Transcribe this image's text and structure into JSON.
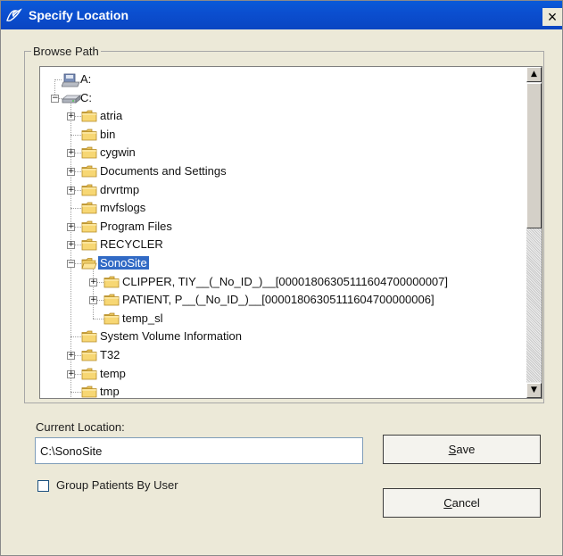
{
  "window": {
    "title": "Specify Location",
    "close_symbol": "×"
  },
  "browse": {
    "group_label": "Browse Path",
    "tree": [
      {
        "label": "A:",
        "icon": "floppy-drive-icon",
        "level": 0,
        "expander": "none"
      },
      {
        "label": "C:",
        "icon": "hard-drive-icon",
        "level": 0,
        "expander": "minus"
      },
      {
        "label": "atria",
        "icon": "folder-icon",
        "level": 1,
        "expander": "plus"
      },
      {
        "label": "bin",
        "icon": "folder-icon",
        "level": 1,
        "expander": "none"
      },
      {
        "label": "cygwin",
        "icon": "folder-icon",
        "level": 1,
        "expander": "plus"
      },
      {
        "label": "Documents and Settings",
        "icon": "folder-icon",
        "level": 1,
        "expander": "plus"
      },
      {
        "label": "drvrtmp",
        "icon": "folder-icon",
        "level": 1,
        "expander": "plus"
      },
      {
        "label": "mvfslogs",
        "icon": "folder-icon",
        "level": 1,
        "expander": "none"
      },
      {
        "label": "Program Files",
        "icon": "folder-icon",
        "level": 1,
        "expander": "plus"
      },
      {
        "label": "RECYCLER",
        "icon": "folder-icon",
        "level": 1,
        "expander": "plus"
      },
      {
        "label": "SonoSite",
        "icon": "folder-open-icon",
        "level": 1,
        "expander": "minus",
        "selected": true
      },
      {
        "label": "CLIPPER, TIY__(_No_ID_)__[00001806305111604700000007]",
        "icon": "folder-icon",
        "level": 2,
        "expander": "plus"
      },
      {
        "label": "PATIENT, P__(_No_ID_)__[00001806305111604700000006]",
        "icon": "folder-icon",
        "level": 2,
        "expander": "plus"
      },
      {
        "label": "temp_sl",
        "icon": "folder-icon",
        "level": 2,
        "expander": "none"
      },
      {
        "label": "System Volume Information",
        "icon": "folder-icon",
        "level": 1,
        "expander": "none"
      },
      {
        "label": "T32",
        "icon": "folder-icon",
        "level": 1,
        "expander": "plus"
      },
      {
        "label": "temp",
        "icon": "folder-icon",
        "level": 1,
        "expander": "plus"
      },
      {
        "label": "tmp",
        "icon": "folder-icon",
        "level": 1,
        "expander": "none"
      }
    ]
  },
  "current_location": {
    "label": "Current Location:",
    "value": "C:\\SonoSite"
  },
  "buttons": {
    "save_label": "Save",
    "save_mnemonic": "S",
    "save_rest": "ave",
    "cancel_label": "Cancel",
    "cancel_mnemonic": "C",
    "cancel_rest": "ancel"
  },
  "options": {
    "group_by_user_label": "Group Patients By User",
    "group_by_user_checked": false
  },
  "colors": {
    "titlebar": "#0a4fd0",
    "selection": "#316ac5",
    "dialog_bg": "#ece9d8"
  }
}
